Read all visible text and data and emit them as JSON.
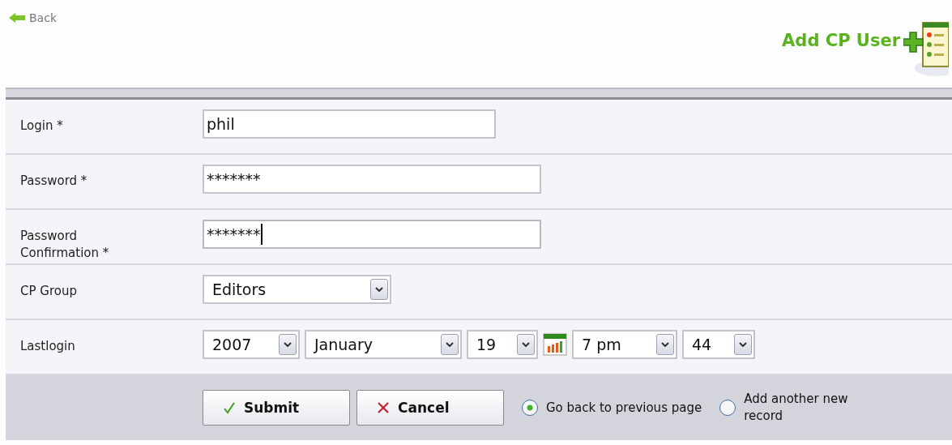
{
  "back_link": {
    "label": "Back"
  },
  "title": "Add CP User",
  "fields": [
    {
      "kind": "text",
      "label": "Login *",
      "value": "phil",
      "focused": false
    },
    {
      "kind": "text",
      "label": "Password *",
      "value": "*******",
      "focused": false
    },
    {
      "kind": "text",
      "label": "Password Confirmation *",
      "value": "*******",
      "focused": true
    },
    {
      "kind": "selects",
      "label": "CP Group",
      "selects": [
        {
          "value": "Editors"
        }
      ]
    },
    {
      "kind": "datetime",
      "label": "Lastlogin",
      "selects": [
        {
          "value": "2007"
        },
        {
          "value": "January"
        },
        {
          "value": "19"
        },
        {
          "kind": "calendar"
        },
        {
          "value": "7 pm"
        },
        {
          "value": "44"
        }
      ]
    }
  ],
  "buttons": [
    {
      "kind": "submit",
      "label": "Submit"
    },
    {
      "kind": "cancel",
      "label": "Cancel"
    }
  ],
  "after_submit": [
    {
      "label": "Go back to previous page",
      "selected": true
    },
    {
      "label": "Add another new record",
      "selected": false
    }
  ]
}
